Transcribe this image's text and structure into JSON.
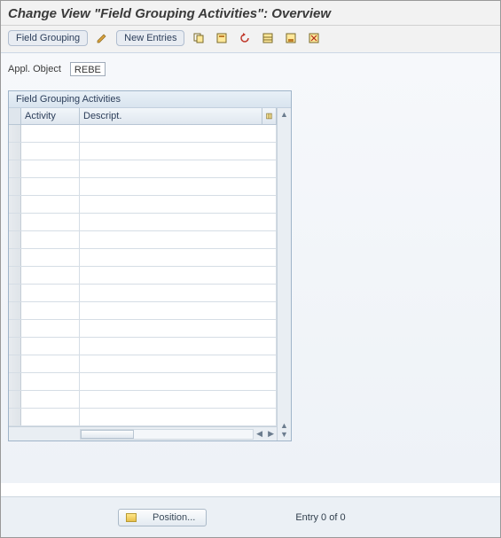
{
  "header": {
    "title": "Change View \"Field Grouping Activities\": Overview"
  },
  "toolbar": {
    "field_grouping_label": "Field Grouping",
    "new_entries_label": "New Entries",
    "icons": {
      "pencil": "pencil-icon",
      "copy": "copy-icon",
      "var1": "variant-icon",
      "undo": "undo-icon",
      "var2": "select-all-icon",
      "var3": "save-variant-icon",
      "var4": "delete-variant-icon"
    }
  },
  "fields": {
    "appl_object_label": "Appl. Object",
    "appl_object_value": "REBE"
  },
  "panel": {
    "title": "Field Grouping Activities",
    "columns": {
      "activity": "Activity",
      "descript": "Descript."
    },
    "rows": [
      {
        "activity": "",
        "descript": ""
      },
      {
        "activity": "",
        "descript": ""
      },
      {
        "activity": "",
        "descript": ""
      },
      {
        "activity": "",
        "descript": ""
      },
      {
        "activity": "",
        "descript": ""
      },
      {
        "activity": "",
        "descript": ""
      },
      {
        "activity": "",
        "descript": ""
      },
      {
        "activity": "",
        "descript": ""
      },
      {
        "activity": "",
        "descript": ""
      },
      {
        "activity": "",
        "descript": ""
      },
      {
        "activity": "",
        "descript": ""
      },
      {
        "activity": "",
        "descript": ""
      },
      {
        "activity": "",
        "descript": ""
      },
      {
        "activity": "",
        "descript": ""
      },
      {
        "activity": "",
        "descript": ""
      },
      {
        "activity": "",
        "descript": ""
      },
      {
        "activity": "",
        "descript": ""
      }
    ]
  },
  "footer": {
    "position_label": "Position...",
    "entry_text": "Entry 0 of 0"
  }
}
